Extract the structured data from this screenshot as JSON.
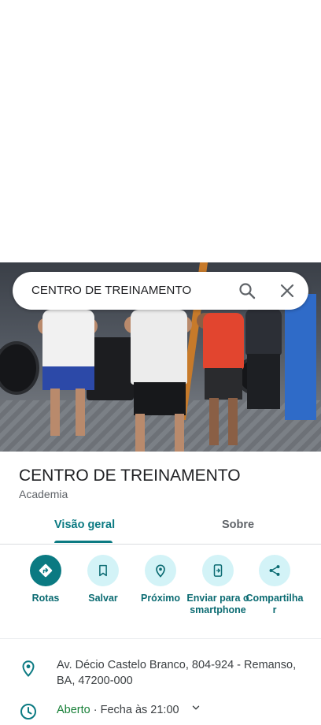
{
  "search": {
    "query": "CENTRO DE TREINAMENTO"
  },
  "place": {
    "name": "CENTRO DE TREINAMENTO",
    "category": "Academia"
  },
  "tabs": [
    {
      "label": "Visão geral"
    },
    {
      "label": "Sobre"
    }
  ],
  "actions": [
    {
      "label": "Rotas"
    },
    {
      "label": "Salvar"
    },
    {
      "label": "Próximo"
    },
    {
      "label": "Enviar para o smartphone"
    },
    {
      "label": "Compartilhar"
    }
  ],
  "info": {
    "address": "Av. Décio Castelo Branco, 804-924 - Remanso, BA, 47200-000",
    "hours_status": "Aberto",
    "hours_detail": " · Fecha às 21:00"
  },
  "colors": {
    "accent": "#0b7a82",
    "accent_light": "#d3f3f7",
    "open_green": "#188038"
  },
  "icons": [
    "search-icon",
    "close-icon",
    "directions-icon",
    "bookmark-icon",
    "nearby-icon",
    "send-to-phone-icon",
    "share-icon",
    "location-pin-icon",
    "clock-icon",
    "chevron-down-icon"
  ]
}
